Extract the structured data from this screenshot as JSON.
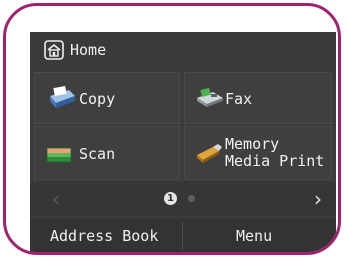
{
  "header": {
    "title": "Home",
    "icon": "home-icon"
  },
  "tiles": [
    {
      "label": "Copy",
      "icon": "copy-icon"
    },
    {
      "label": "Fax",
      "icon": "fax-icon"
    },
    {
      "label": "Scan",
      "icon": "scan-icon"
    },
    {
      "label_line1": "Memory",
      "label_line2": "Media Print",
      "icon": "memory-media-icon"
    }
  ],
  "pager": {
    "current_page": "1",
    "prev_icon": "chevron-left-icon",
    "next_icon": "chevron-right-icon",
    "prev_glyph": "‹",
    "next_glyph": "›"
  },
  "footer": {
    "address_book_label": "Address Book",
    "menu_label": "Menu"
  },
  "colors": {
    "frame_accent": "#a3226f",
    "screen_bg": "#3b3b3b"
  }
}
